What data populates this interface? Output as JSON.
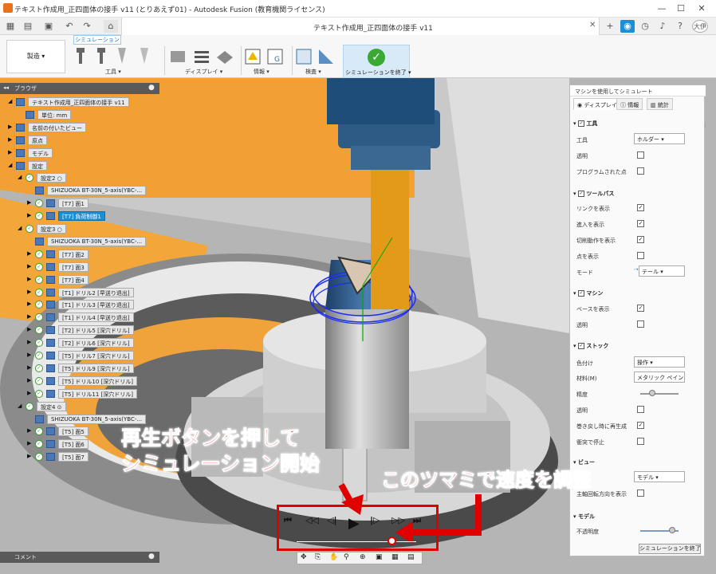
{
  "window": {
    "title": "テキスト作成用_正四面体の接手 v11 (とりあえず01) - Autodesk Fusion (教育機関ライセンス)",
    "min": "—",
    "max": "☐",
    "close": "✕"
  },
  "tabs": {
    "doc_title": "テキスト作成用_正四面体の接手 v11",
    "close": "✕",
    "user": "大伊"
  },
  "ribbon": {
    "sim_tab": "シミュレーション",
    "mfg_workspace": "製造 ▾",
    "groups": {
      "tool": "工具 ▾",
      "display": "ディスプレイ ▾",
      "info": "情報 ▾",
      "inspect": "検査 ▾"
    },
    "finish": "シミュレーションを終了 ▾"
  },
  "browser": {
    "title": "ブラウザ",
    "rows": [
      {
        "label": "テキスト作成用_正四面体の接手 v11",
        "indent": 1,
        "chev": "◢",
        "icon": true
      },
      {
        "label": "単位: mm",
        "indent": 2,
        "chev": "",
        "icon": true
      },
      {
        "label": "名前の付いたビュー",
        "indent": 1,
        "chev": "▶",
        "icon": true
      },
      {
        "label": "原点",
        "indent": 1,
        "chev": "▶",
        "icon": true
      },
      {
        "label": "モデル",
        "indent": 1,
        "chev": "▶",
        "icon": true
      },
      {
        "label": "設定",
        "indent": 1,
        "chev": "◢",
        "icon": true
      },
      {
        "label": "設定2 ○",
        "indent": 2,
        "chev": "◢",
        "ok": true
      },
      {
        "label": "SHIZUOKA BT-30N_5-axis(YBC-...",
        "indent": 3,
        "chev": "",
        "icon": true
      },
      {
        "label": "[T7] 面1",
        "indent": 3,
        "chev": "▶",
        "ok": true,
        "icon": true
      },
      {
        "label": "[T7] 負荷制御1",
        "indent": 3,
        "chev": "▶",
        "ok": true,
        "icon": true,
        "selected": true
      },
      {
        "label": "設定3 ○",
        "indent": 2,
        "chev": "◢",
        "ok": true
      },
      {
        "label": "SHIZUOKA BT-30N_5-axis(YBC-...",
        "indent": 3,
        "chev": "",
        "icon": true
      },
      {
        "label": "[T7] 面2",
        "indent": 3,
        "chev": "▶",
        "ok": true,
        "icon": true
      },
      {
        "label": "[T7] 面3",
        "indent": 3,
        "chev": "▶",
        "ok": true,
        "icon": true
      },
      {
        "label": "[T7] 面4",
        "indent": 3,
        "chev": "▶",
        "ok": true,
        "icon": true
      },
      {
        "label": "[T1] ドリル2 [早送り退出]",
        "indent": 3,
        "chev": "▶",
        "ok": true,
        "icon": true
      },
      {
        "label": "[T1] ドリル3 [早送り退出]",
        "indent": 3,
        "chev": "▶",
        "ok": true,
        "icon": true
      },
      {
        "label": "[T1] ドリル4 [早送り退出]",
        "indent": 3,
        "chev": "▶",
        "ok": true,
        "icon": true
      },
      {
        "label": "[T2] ドリル5 [深穴ドリル]",
        "indent": 3,
        "chev": "▶",
        "ok": true,
        "icon": true
      },
      {
        "label": "[T2] ドリル6 [深穴ドリル]",
        "indent": 3,
        "chev": "▶",
        "ok": true,
        "icon": true
      },
      {
        "label": "[T5] ドリル7 [深穴ドリル]",
        "indent": 3,
        "chev": "▶",
        "ok": true,
        "icon": true
      },
      {
        "label": "[T5] ドリル9 [深穴ドリル]",
        "indent": 3,
        "chev": "▶",
        "ok": true,
        "icon": true
      },
      {
        "label": "[T5] ドリル10 [深穴ドリル]",
        "indent": 3,
        "chev": "▶",
        "ok": true,
        "icon": true
      },
      {
        "label": "[T5] ドリル11 [深穴ドリル]",
        "indent": 3,
        "chev": "▶",
        "ok": true,
        "icon": true
      },
      {
        "label": "設定4 ⊙",
        "indent": 2,
        "chev": "◢",
        "ok": true
      },
      {
        "label": "SHIZUOKA BT-30N_5-axis(YBC-...",
        "indent": 3,
        "chev": "",
        "icon": true
      },
      {
        "label": "[T5] 面5",
        "indent": 3,
        "chev": "▶",
        "ok": true,
        "icon": true
      },
      {
        "label": "[T5] 面6",
        "indent": 3,
        "chev": "▶",
        "ok": true,
        "icon": true
      },
      {
        "label": "[T5] 面7",
        "indent": 3,
        "chev": "▶",
        "ok": true,
        "icon": true
      }
    ],
    "comment": "コメント"
  },
  "panel": {
    "title": "マシンを使用してシミュレート",
    "tabs": [
      "ディスプレイ",
      "情報",
      "統計"
    ],
    "sections": {
      "tool": {
        "label": "工具",
        "tool_label": "工具",
        "tool_value": "ホルダー ▾",
        "transparent": "透明",
        "programmed": "プログラムされた点"
      },
      "toolpath": {
        "label": "ツールパス",
        "links": "リンクを表示",
        "leads": "進入を表示",
        "cut": "切削動作を表示",
        "points": "点を表示",
        "mode_label": "モード",
        "mode_value": "テール ▾"
      },
      "machine": {
        "label": "マシン",
        "base": "ベースを表示",
        "transparent": "透明"
      },
      "stock": {
        "label": "ストック",
        "color_label": "色付け",
        "color_value": "操作 ▾",
        "material_label": "材料(M)",
        "material_value": "メタリック ペイン... ▾",
        "accuracy": "精度",
        "transparent": "透明",
        "regen": "巻き戻し時に再生成",
        "stop": "衝突で停止"
      },
      "view": {
        "label": "ビュー",
        "follow_value": "モデル ▾",
        "spindle": "主軸回転方向を表示"
      },
      "model": {
        "label": "モデル",
        "opacity": "不透明度"
      }
    },
    "finish_button": "シミュレーションを終了"
  },
  "annotations": {
    "line1": "再生ボタンを押して",
    "line2": "シミュレーション開始",
    "speed": "このツマミで速度を調整"
  },
  "playback": [
    "⏮",
    "◁◁",
    "◁|",
    "▶",
    "|▷",
    "▷▷",
    "⏭"
  ],
  "colors": {
    "accent": "#1b8fd6",
    "annotation": "#e00000",
    "orange_model": "#f5a636",
    "finish_green": "#3aaa35"
  }
}
